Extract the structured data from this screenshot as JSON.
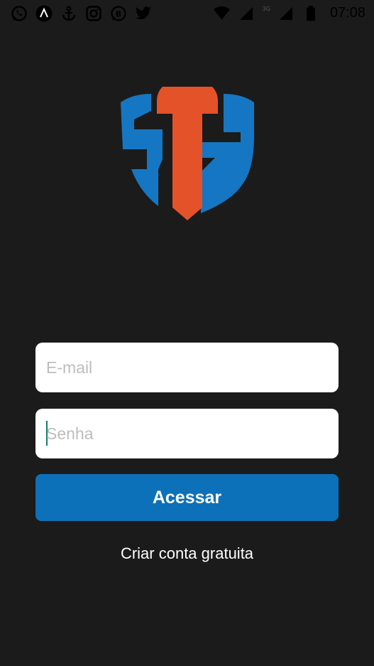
{
  "status_bar": {
    "time": "07:08",
    "network_type": "3G",
    "notification_icons": [
      "whatsapp-icon",
      "app-a-icon",
      "anchor-icon",
      "instagram-icon",
      "b-messenger-icon",
      "twitter-icon"
    ],
    "system_icons": [
      "wifi-icon",
      "signal-icon",
      "signal-icon",
      "battery-icon"
    ]
  },
  "logo": {
    "name": "shield-st-logo",
    "colors": {
      "blue": "#1577c3",
      "orange": "#e4522a"
    }
  },
  "login_form": {
    "email": {
      "value": "",
      "placeholder": "E-mail"
    },
    "password": {
      "value": "",
      "placeholder": "Senha"
    },
    "submit_label": "Acessar",
    "create_account_label": "Criar conta gratuita"
  },
  "colors": {
    "background": "#1b1b1b",
    "primary_button": "#0c71b9",
    "input_background": "#ffffff",
    "placeholder": "#bdbdbd",
    "cursor": "#0e7c6b"
  }
}
